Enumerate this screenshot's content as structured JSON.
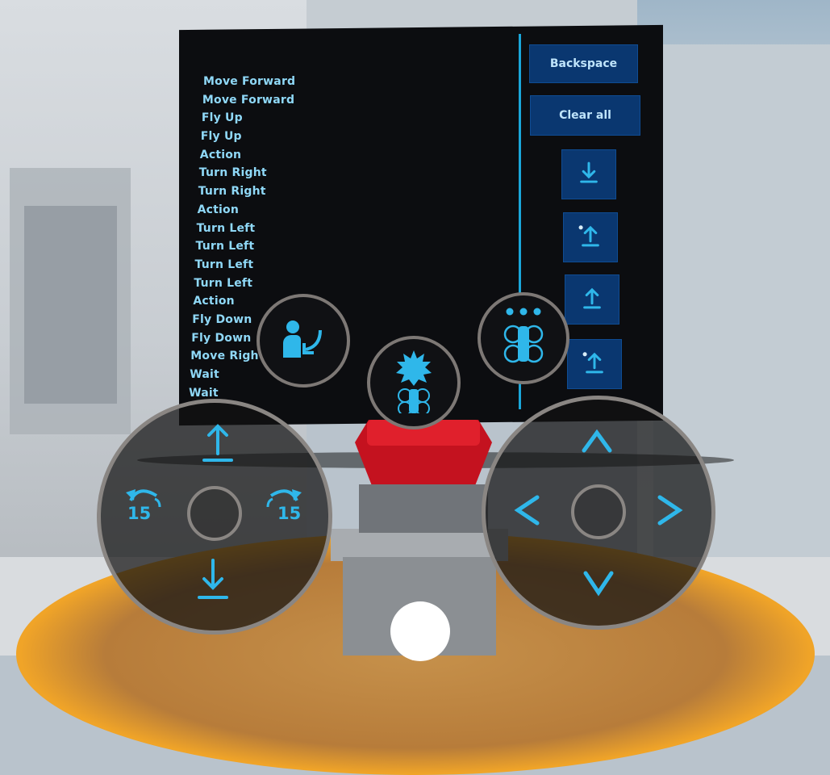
{
  "command_list": [
    "Move Forward",
    "Move Forward",
    "Fly Up",
    "Fly Up",
    "Action",
    "Turn Right",
    "Turn Right",
    "Action",
    "Turn Left",
    "Turn Left",
    "Turn Left",
    "Turn Left",
    "Action",
    "Fly Down",
    "Fly Down",
    "Move Righ",
    "Wait",
    "Wait"
  ],
  "panel_buttons": {
    "backspace_label": "Backspace",
    "clear_all_label": "Clear all"
  },
  "palette_icons": [
    "fly-down-icon",
    "action-fly-up-icon",
    "fly-up-icon",
    "action-fly-up-icon"
  ],
  "round_buttons": [
    "action-person-turn-icon",
    "drone-action-icon",
    "drone-wait-icon"
  ],
  "left_joystick": {
    "turn_left_value": "15",
    "turn_right_value": "15",
    "controls": [
      "fly-up-icon",
      "turn-left-icon",
      "turn-right-icon",
      "fly-down-icon"
    ]
  },
  "right_joystick": {
    "controls": [
      "chevron-up-icon",
      "chevron-left-icon",
      "chevron-right-icon",
      "chevron-down-icon"
    ]
  },
  "colors": {
    "accent": "#1aa6d9",
    "text": "#8fd8f7",
    "button_bg": "#0a3770"
  }
}
